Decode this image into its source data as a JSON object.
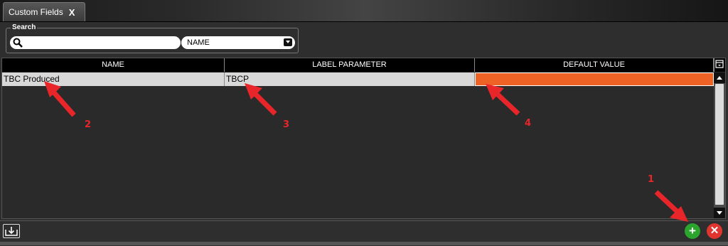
{
  "tab": {
    "title": "Custom Fields",
    "close_label": "X"
  },
  "search": {
    "legend": "Search",
    "input_value": "",
    "field_selected": "NAME"
  },
  "grid": {
    "columns": [
      "NAME",
      "LABEL PARAMETER",
      "DEFAULT VALUE"
    ],
    "rows": [
      {
        "name": "TBC Produced",
        "label_parameter": "TBCP",
        "default_value": ""
      }
    ]
  },
  "footer": {
    "add_symbol": "+",
    "delete_symbol": "✕"
  },
  "annotations": {
    "n1": "1",
    "n2": "2",
    "n3": "3",
    "n4": "4"
  },
  "colors": {
    "default_value_cell": "#ef6226",
    "add_button": "#2ba52e",
    "delete_button": "#e0342f",
    "annotation_arrow": "#e8262a"
  }
}
